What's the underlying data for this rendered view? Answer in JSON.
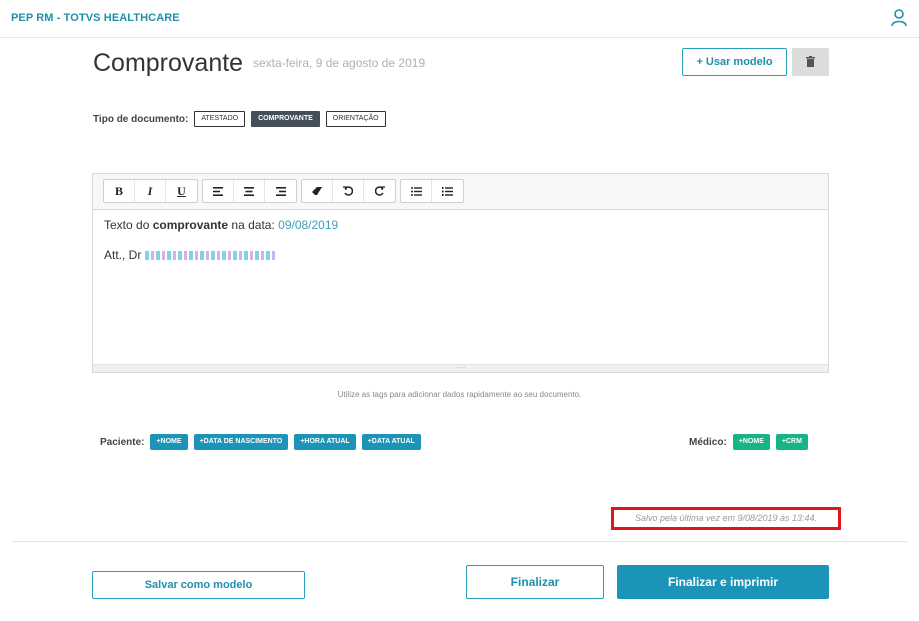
{
  "app": {
    "title": "PEP RM - TOTVS HEALTHCARE"
  },
  "colors": {
    "brand": "#1c94b8",
    "green": "#17b488",
    "highlight_red": "#e0161e",
    "chip_active": "#444f59"
  },
  "header": {
    "title": "Comprovante",
    "date": "sexta-feira, 9 de agosto de 2019",
    "use_template_label": "+ Usar modelo",
    "delete_icon": "trash-icon",
    "user_icon": "user-icon"
  },
  "tipo": {
    "label": "Tipo de documento:",
    "options": [
      {
        "label": "ATESTADO",
        "active": false
      },
      {
        "label": "COMPROVANTE",
        "active": true
      },
      {
        "label": "ORIENTAÇÃO",
        "active": false
      }
    ]
  },
  "editor": {
    "toolbar": [
      [
        "bold-icon",
        "italic-icon",
        "underline-icon"
      ],
      [
        "align-left-icon",
        "align-center-icon",
        "align-right-icon"
      ],
      [
        "eraser-icon",
        "undo-icon",
        "redo-icon"
      ],
      [
        "bullet-list-icon",
        "numbered-list-icon"
      ]
    ],
    "line1_prefix": "Texto do",
    "line1_bold": "comprovante",
    "line1_mid": "na data:",
    "line1_date": "09/08/2019",
    "line2_prefix": "Att., Dr"
  },
  "hint": "Utilize as tags para adicionar dados rapidamente ao seu documento.",
  "tags": {
    "paciente_label": "Paciente:",
    "paciente": [
      "+NOME",
      "+DATA DE NASCIMENTO",
      "+HORA ATUAL",
      "+DATA ATUAL"
    ],
    "medico_label": "Médico:",
    "medico": [
      "+NOME",
      "+CRM"
    ]
  },
  "status": {
    "saved": "Salvo pela última vez em 9/08/2019 às 13:44."
  },
  "footer": {
    "save_template_label": "Salvar como modelo",
    "finalize_label": "Finalizar",
    "finalize_print_label": "Finalizar e imprimir"
  }
}
